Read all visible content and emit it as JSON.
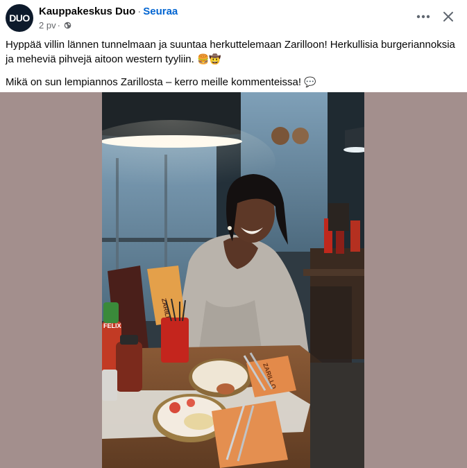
{
  "post": {
    "page_name": "Kauppakeskus Duo",
    "separator": "·",
    "follow_label": "Seuraa",
    "time": "2 pv",
    "time_sep": "·",
    "avatar_text": "DUO",
    "text_line1": "Hyppää villin lännen tunnelmaan ja suuntaa herkuttelemaan Zarilloon! Herkullisia burgeriannoksia ja meheviä pihvejä aitoon western tyyliin.",
    "text_line2": "Mikä on sun lempiannos Zarillosta – kerro meille kommenteissa!",
    "emoji_burger": "🍔",
    "emoji_cowboy": "🤠",
    "emoji_speech": "💬"
  },
  "photo": {
    "menu_label": "ZARILLO",
    "napkin_label": "ZARILLO",
    "bottle_label": "FELIX"
  },
  "icons": {
    "more": "more-horizontal-icon",
    "close": "close-icon",
    "privacy": "globe-icon"
  },
  "colors": {
    "link": "#0064d1",
    "meta": "#65676b",
    "media_bg": "#a38f8d",
    "avatar_bg": "#0d1a2b"
  }
}
